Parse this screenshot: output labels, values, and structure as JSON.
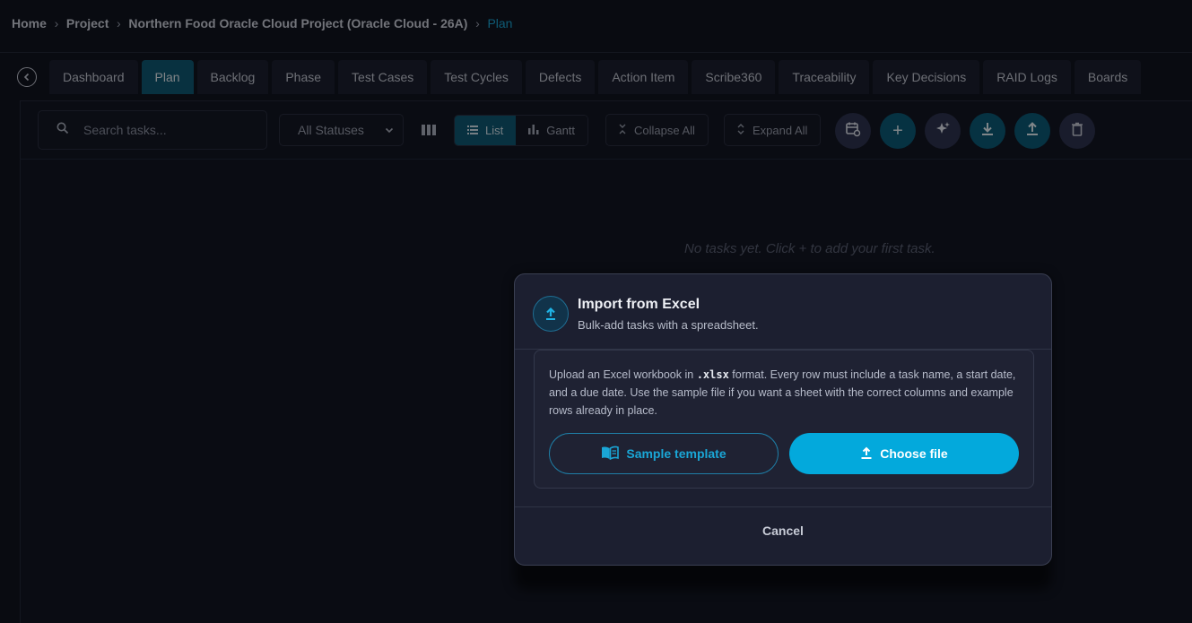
{
  "breadcrumb": [
    {
      "label": "Home"
    },
    {
      "label": "Project"
    },
    {
      "label": "Northern Food Oracle Cloud Project (Oracle Cloud - 26A)"
    },
    {
      "label": "Plan"
    }
  ],
  "tabs": [
    {
      "label": "Dashboard"
    },
    {
      "label": "Plan"
    },
    {
      "label": "Backlog"
    },
    {
      "label": "Phase"
    },
    {
      "label": "Test Cases"
    },
    {
      "label": "Test Cycles"
    },
    {
      "label": "Defects"
    },
    {
      "label": "Action Item"
    },
    {
      "label": "Scribe360"
    },
    {
      "label": "Traceability"
    },
    {
      "label": "Key Decisions"
    },
    {
      "label": "RAID Logs"
    },
    {
      "label": "Boards"
    }
  ],
  "active_tab": "Plan",
  "toolbar": {
    "search_placeholder": "Search tasks...",
    "status_filter": "All Statuses",
    "list_label": "List",
    "gantt_label": "Gantt",
    "collapse_label": "Collapse All",
    "expand_label": "Expand All",
    "add_symbol": "+"
  },
  "empty_state": "No tasks yet. Click + to add your first task.",
  "modal": {
    "title": "Import from Excel",
    "subtitle": "Bulk-add tasks with a spreadsheet.",
    "desc_before": "Upload an Excel workbook in ",
    "desc_code": ".xlsx",
    "desc_after": " format. Every row must include a task name, a start date, and a due date. Use the sample file if you want a sheet with the correct columns and example rows already in place.",
    "sample_label": "Sample template",
    "choose_label": "Choose file",
    "cancel_label": "Cancel"
  },
  "colors": {
    "accent": "#03a9dc",
    "active_tab": "#0f5a76",
    "background": "#121420",
    "modal": "#1c1f30"
  }
}
